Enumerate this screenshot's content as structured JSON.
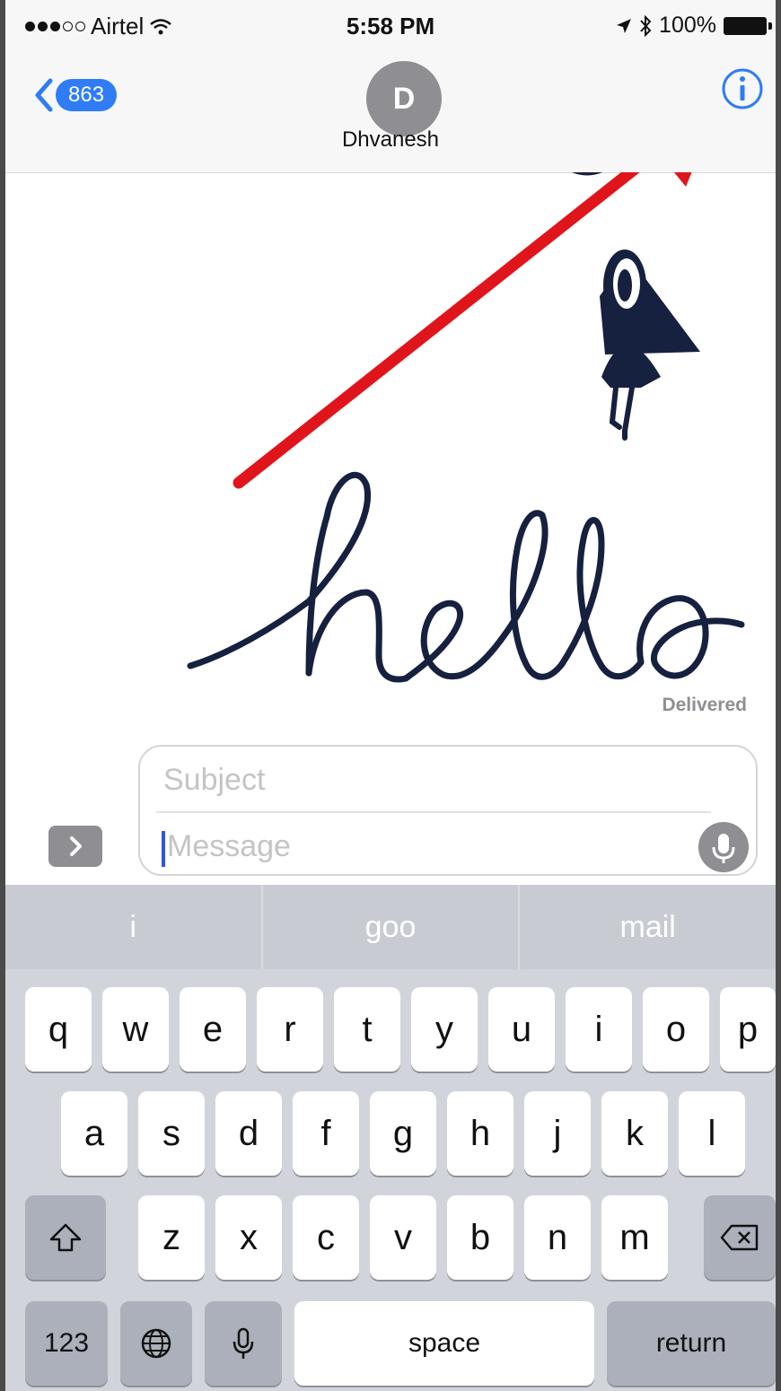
{
  "status_bar": {
    "carrier": "Airtel",
    "time": "5:58 PM",
    "battery": "100%"
  },
  "header": {
    "back_count": "863",
    "avatar_initial": "D",
    "contact_name": "Dhvanesh"
  },
  "conversation": {
    "status": "Delivered"
  },
  "compose": {
    "subject_placeholder": "Subject",
    "message_placeholder": "Message"
  },
  "keyboard": {
    "suggestions": [
      "i",
      "goo",
      "mail"
    ],
    "row1": [
      "q",
      "w",
      "e",
      "r",
      "t",
      "y",
      "u",
      "i",
      "o",
      "p"
    ],
    "row2": [
      "a",
      "s",
      "d",
      "f",
      "g",
      "h",
      "j",
      "k",
      "l"
    ],
    "row3": [
      "z",
      "x",
      "c",
      "v",
      "b",
      "n",
      "m"
    ],
    "numbers_key": "123",
    "space_key": "space",
    "return_key": "return"
  },
  "colors": {
    "accent": "#2f7cf6",
    "arrow": "#e0151b",
    "ink": "#16203f"
  }
}
